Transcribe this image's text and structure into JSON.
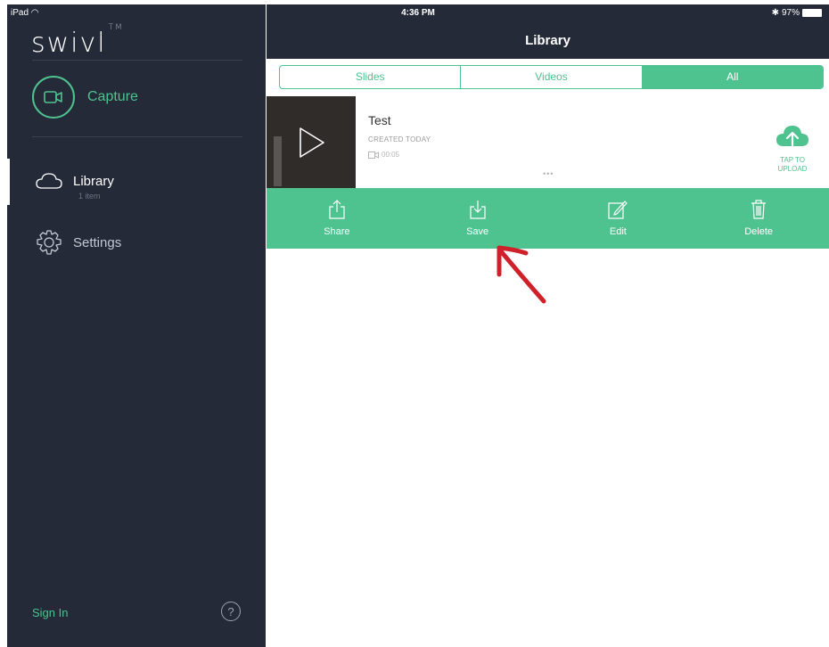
{
  "status_bar": {
    "carrier": "iPad",
    "time": "4:36 PM",
    "battery": "97%"
  },
  "sidebar": {
    "logo": "swivl",
    "logo_tm": "TM",
    "capture_label": "Capture",
    "items": [
      {
        "label": "Library",
        "sub": "1 item"
      },
      {
        "label": "Settings"
      }
    ],
    "sign_in": "Sign In",
    "help": "?"
  },
  "main": {
    "title": "Library",
    "tabs": [
      {
        "label": "Slides",
        "active": false
      },
      {
        "label": "Videos",
        "active": false
      },
      {
        "label": "All",
        "active": true
      }
    ],
    "item": {
      "title": "Test",
      "created": "CREATED TODAY",
      "duration": "00:05",
      "more": "•••",
      "upload_label": "TAP TO\nUPLOAD"
    },
    "actions": [
      {
        "label": "Share",
        "icon": "share-icon"
      },
      {
        "label": "Save",
        "icon": "save-icon"
      },
      {
        "label": "Edit",
        "icon": "edit-icon"
      },
      {
        "label": "Delete",
        "icon": "trash-icon"
      }
    ]
  },
  "colors": {
    "accent": "#4ec28f",
    "sidebar": "#252a38",
    "annotation": "#d0202a"
  }
}
